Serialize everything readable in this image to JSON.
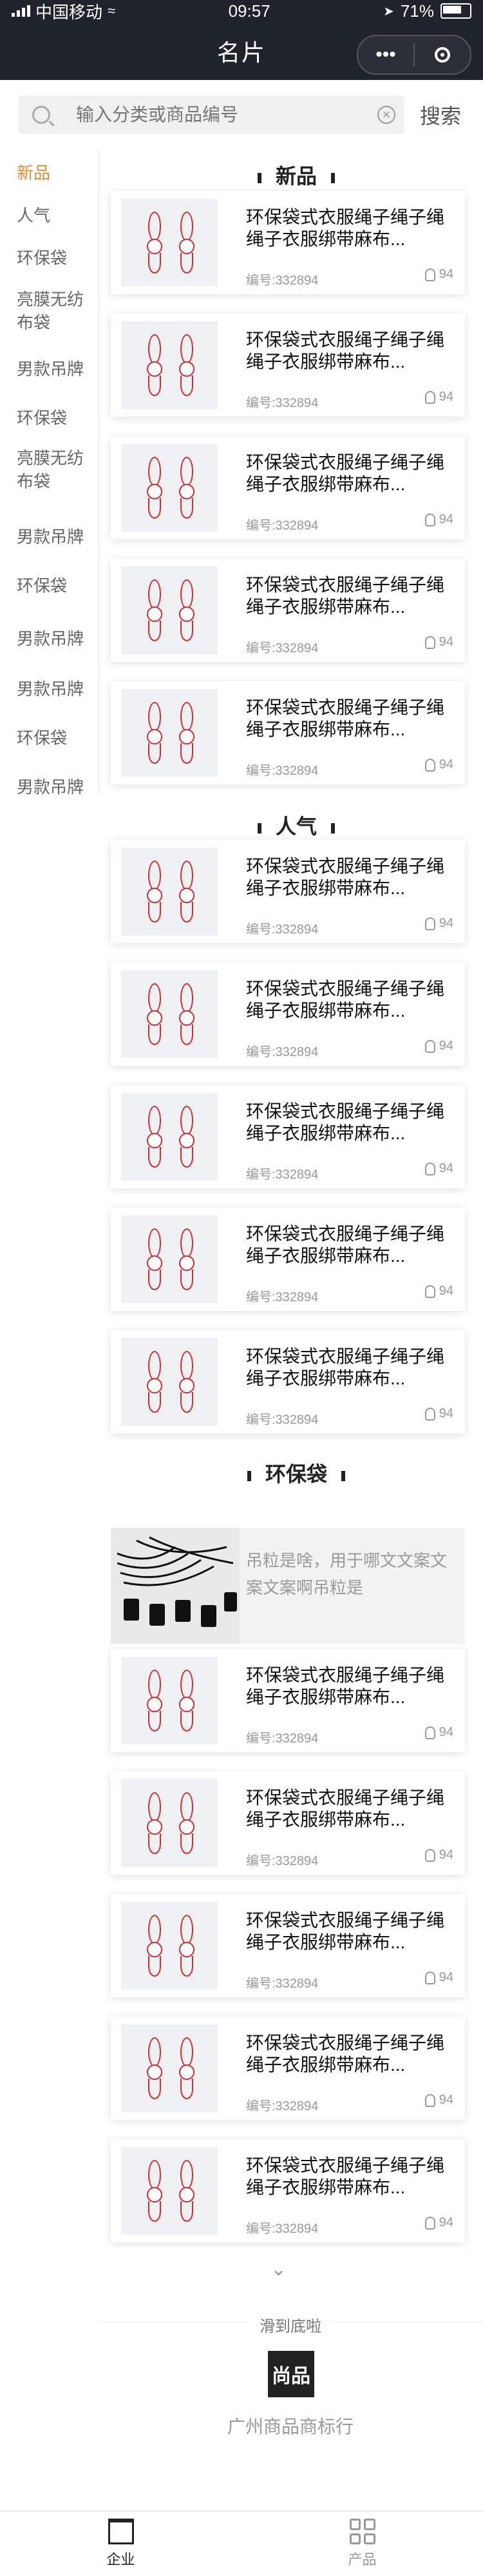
{
  "status_bar": {
    "carrier": "中国移动",
    "time": "09:57",
    "battery": "71%"
  },
  "nav": {
    "title": "名片"
  },
  "search": {
    "placeholder": "输入分类或商品编号",
    "button": "搜索"
  },
  "sidebar": {
    "items": [
      {
        "label": "新品",
        "active": true
      },
      {
        "label": "人气"
      },
      {
        "label": "环保袋"
      },
      {
        "label": "亮膜无纺布袋"
      },
      {
        "label": "男款吊牌"
      },
      {
        "label": "环保袋"
      },
      {
        "label": "亮膜无纺布袋"
      },
      {
        "label": "男款吊牌"
      },
      {
        "label": "环保袋"
      },
      {
        "label": "男款吊牌"
      },
      {
        "label": "男款吊牌"
      },
      {
        "label": "环保袋"
      },
      {
        "label": "男款吊牌"
      }
    ]
  },
  "sections": [
    {
      "title": "新品"
    },
    {
      "title": "人气"
    },
    {
      "title": "环保袋"
    }
  ],
  "product": {
    "title": "环保袋式衣服绳子绳子绳绳子衣服绑带麻布...",
    "code": "编号:332894",
    "likes": "94"
  },
  "banner": {
    "text": "吊粒是啥，用于哪文文案文案文案啊吊粒是"
  },
  "footer": {
    "hint": "滑到底啦",
    "logo": "尚品",
    "company": "广州商品商标行"
  },
  "tabbar": {
    "tabs": [
      {
        "label": "企业",
        "active": true
      },
      {
        "label": "产品"
      }
    ]
  }
}
